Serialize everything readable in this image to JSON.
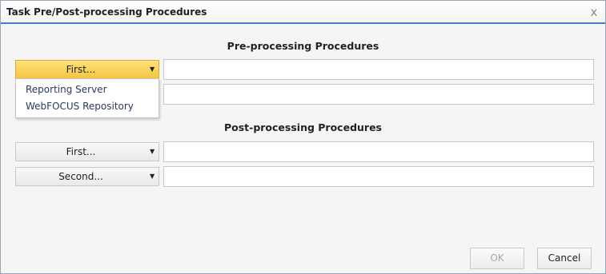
{
  "window": {
    "title": "Task Pre/Post-processing Procedures",
    "close_glyph": "x"
  },
  "pre": {
    "heading": "Pre-processing Procedures",
    "rows": [
      {
        "selector_label": "First...",
        "value": ""
      },
      {
        "selector_label": "",
        "value": ""
      }
    ]
  },
  "menu": {
    "items": [
      "Reporting Server",
      "WebFOCUS Repository"
    ]
  },
  "post": {
    "heading": "Post-processing Procedures",
    "rows": [
      {
        "selector_label": "First...",
        "value": ""
      },
      {
        "selector_label": "Second...",
        "value": ""
      }
    ]
  },
  "buttons": {
    "ok_label": "OK",
    "cancel_label": "Cancel"
  },
  "icons": {
    "dropdown": "chevron-down-icon",
    "close": "close-icon"
  },
  "colors": {
    "active_dropdown": "#f5c542",
    "title_underline": "#4a7ec2"
  }
}
